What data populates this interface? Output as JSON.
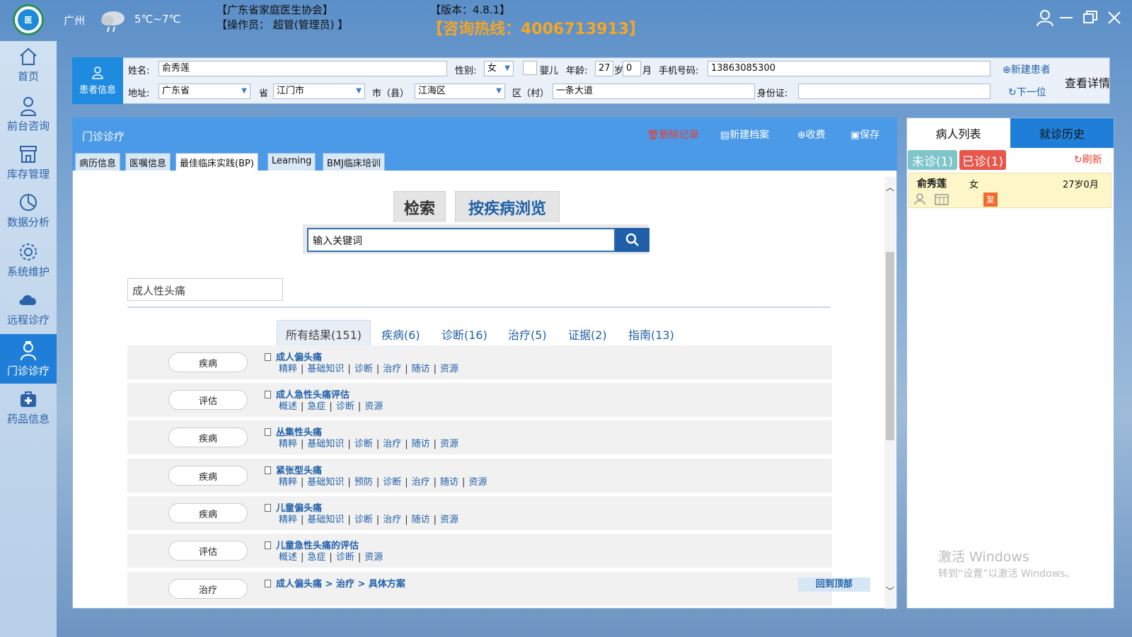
{
  "header": {
    "city": "广州",
    "weather": "5℃~7℃",
    "org": "【广东省家庭医生协会】",
    "operator": "【操作员： 超管(管理员) 】",
    "version": "【版本：4.8.1】",
    "hotline": "【咨询热线：4006713913】"
  },
  "sidebar": {
    "items": [
      {
        "label": "首页",
        "icon": "home-icon"
      },
      {
        "label": "前台咨询",
        "icon": "receptionist-icon"
      },
      {
        "label": "库存管理",
        "icon": "store-icon"
      },
      {
        "label": "数据分析",
        "icon": "chart-icon"
      },
      {
        "label": "系统维护",
        "icon": "gear-icon"
      },
      {
        "label": "远程诊疗",
        "icon": "cloud-icon"
      },
      {
        "label": "门诊诊疗",
        "icon": "doctor-icon"
      },
      {
        "label": "药品信息",
        "icon": "medkit-icon"
      }
    ]
  },
  "patient": {
    "tab_label": "患者信息",
    "name_label": "姓名:",
    "name": "俞秀莲",
    "sex_label": "性别:",
    "sex": "女",
    "infant_label": "婴儿",
    "age_label": "年龄:",
    "age_years": "27",
    "years_unit": "岁",
    "age_months": "0",
    "months_unit": "月",
    "phone_label": "手机号码:",
    "phone": "13863085300",
    "new_patient": "新建患者",
    "details": "查看详情",
    "addr_label": "地址:",
    "province": "广东省",
    "prov_label": "省",
    "city": "江门市",
    "city_label": "市（县）",
    "district": "江海区",
    "village_label": "区（村）",
    "street": "一条大道",
    "id_label": "身份证:",
    "id_value": "",
    "next": "下一位"
  },
  "main": {
    "title": "门诊诊疗",
    "delete": "删除记录",
    "new_file": "新建档案",
    "charge": "收费",
    "save": "保存",
    "tabs": [
      "病历信息",
      "医嘱信息",
      "最佳临床实践(BP)",
      "Learning",
      "BMJ临床培训"
    ],
    "search_tabs": [
      "检索",
      "按疾病浏览"
    ],
    "search_placeholder": "输入关键词",
    "keyword": "成人性头痛",
    "result_tabs": [
      "所有结果(151)",
      "疾病(6)",
      "诊断(16)",
      "治疗(5)",
      "证据(2)",
      "指南(13)"
    ],
    "results": [
      {
        "tag": "疾病",
        "title": "成人偏头痛",
        "links": [
          "精粹",
          "基础知识",
          "诊断",
          "治疗",
          "随访",
          "资源"
        ]
      },
      {
        "tag": "评估",
        "title": "成人急性头痛评估",
        "links": [
          "概述",
          "急症",
          "诊断",
          "资源"
        ]
      },
      {
        "tag": "疾病",
        "title": "丛集性头痛",
        "links": [
          "精粹",
          "基础知识",
          "诊断",
          "治疗",
          "随访",
          "资源"
        ]
      },
      {
        "tag": "疾病",
        "title": "紧张型头痛",
        "links": [
          "精粹",
          "基础知识",
          "预防",
          "诊断",
          "治疗",
          "随访",
          "资源"
        ]
      },
      {
        "tag": "疾病",
        "title": "儿童偏头痛",
        "links": [
          "精粹",
          "基础知识",
          "诊断",
          "治疗",
          "随访",
          "资源"
        ]
      },
      {
        "tag": "评估",
        "title": "儿童急性头痛的评估",
        "links": [
          "概述",
          "急症",
          "诊断",
          "资源"
        ]
      },
      {
        "tag": "治疗",
        "title": "成人偏头痛 > 治疗 > 具体方案",
        "links": []
      }
    ],
    "back_top": "回到顶部"
  },
  "right": {
    "tab1": "病人列表",
    "tab2": "就诊历史",
    "pending": "未诊(1)",
    "done": "已诊(1)",
    "refresh": "刷新",
    "patient_name": "俞秀莲",
    "patient_sex": "女",
    "patient_age": "27岁0月",
    "revisit": "复",
    "watermark1": "激活 Windows",
    "watermark2": "转到“设置”以激活 Windows。"
  }
}
